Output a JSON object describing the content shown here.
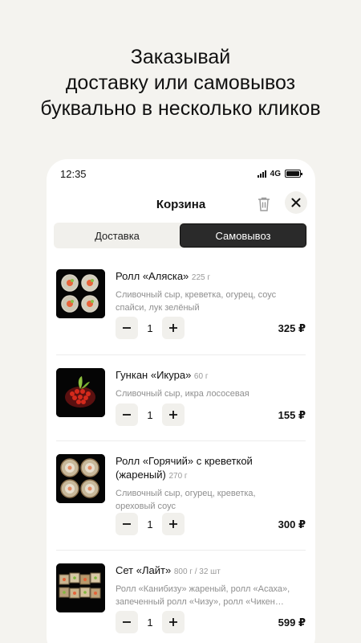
{
  "promo": {
    "line1": "Заказывай",
    "line2": "доставку или самовывоз",
    "line3": "буквально в несколько кликов"
  },
  "statusbar": {
    "time": "12:35",
    "network": "4G"
  },
  "header": {
    "title": "Корзина"
  },
  "segments": {
    "delivery": "Доставка",
    "pickup": "Самовывоз",
    "active": "pickup"
  },
  "cart": {
    "items": [
      {
        "name": "Ролл «Аляска»",
        "weight": "225 г",
        "desc": "Сливочный сыр, креветка, огурец, соус спайси, лук зелёный",
        "qty": "1",
        "price": "325 ₽"
      },
      {
        "name": "Гункан «Икура»",
        "weight": "60 г",
        "desc": "Сливочный сыр, икра лососевая",
        "qty": "1",
        "price": "155 ₽"
      },
      {
        "name": "Ролл «Горячий» с креветкой (жареный)",
        "weight": "270 г",
        "desc": "Сливочный сыр, огурец, креветка, ореховый соус",
        "qty": "1",
        "price": "300 ₽"
      },
      {
        "name": "Сет «Лайт»",
        "weight": "800 г / 32 шт",
        "desc": "Ролл «Канибизу» жареный, ролл «Асаха», запеченный ролл «Чизу», ролл «Чикен…",
        "qty": "1",
        "price": "599 ₽"
      }
    ]
  },
  "colors": {
    "accent": "#2a2a2a",
    "background": "#f4f3ef",
    "muted": "#8f8f8f",
    "button_bg": "#f1f0ec"
  }
}
